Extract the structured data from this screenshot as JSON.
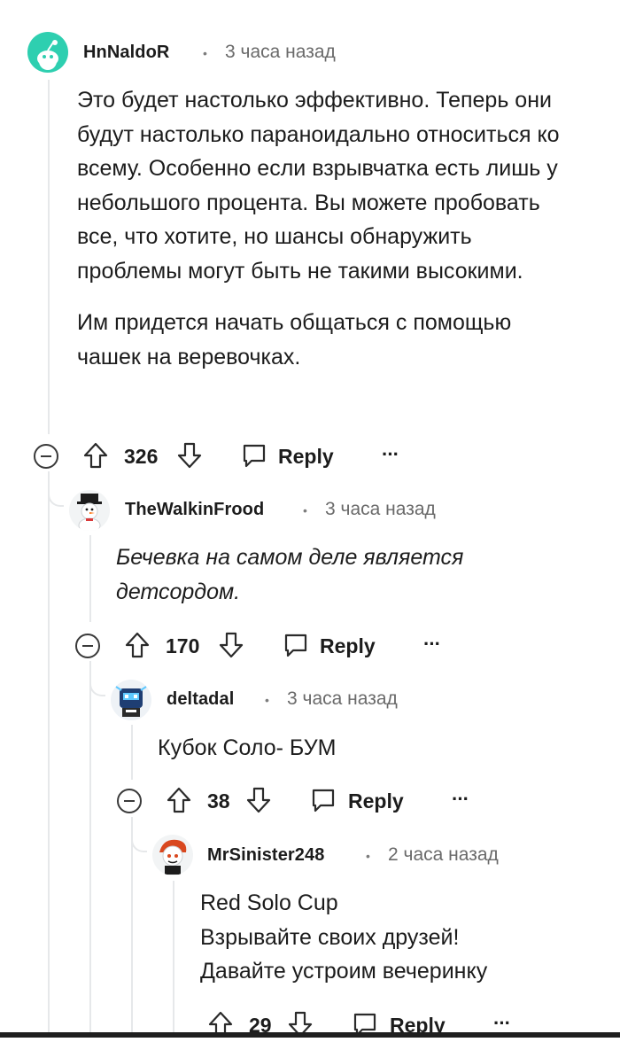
{
  "comments": [
    {
      "username": "HnNaldoR",
      "time": "3 часа назад",
      "paragraphs": [
        "Это будет настолько эффективно. Теперь они будут настолько параноидально относиться ко всему. Особенно если взрывчатка есть лишь у небольшого процента. Вы можете пробовать все, что хотите, но шансы обнаружить проблемы могут быть не такими высокими.",
        "Им придется начать общаться с помощью чашек на веревочках."
      ],
      "score": "326",
      "reply_label": "Reply",
      "more_label": "···"
    },
    {
      "username": "TheWalkinFrood",
      "time": "3 часа назад",
      "paragraphs": [
        "Бечевка на самом деле является детсордом."
      ],
      "score": "170",
      "reply_label": "Reply",
      "more_label": "···"
    },
    {
      "username": "deltadal",
      "time": "3 часа назад",
      "paragraphs": [
        "Кубок Соло- БУМ"
      ],
      "score": "38",
      "reply_label": "Reply",
      "more_label": "···"
    },
    {
      "username": "MrSinister248",
      "time": "2 часа назад",
      "lines": [
        "Red Solo Cup",
        "Взрывайте своих друзей!",
        "Давайте устроим вечеринку"
      ],
      "score": "29",
      "reply_label": "Reply",
      "more_label": "···"
    }
  ],
  "separator": "•",
  "colors": {
    "avatar1": "#2ecfb0",
    "thread": "#e6e8ea",
    "text": "#1c1c1c",
    "meta": "#6a6a6a"
  }
}
